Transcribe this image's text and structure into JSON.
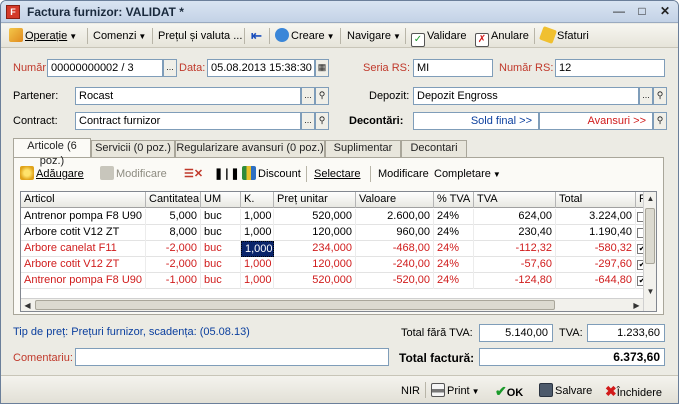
{
  "window": {
    "title": "Factura furnizor: VALIDAT *",
    "app_icon": "F"
  },
  "toolbar": {
    "operatie": "Operație",
    "comenzi": "Comenzi",
    "pretul": "Prețul și valuta ...",
    "creare": "Creare",
    "navigare": "Navigare",
    "validare": "Validare",
    "anulare": "Anulare",
    "sfaturi": "Sfaturi"
  },
  "form": {
    "numar_label": "Număr:",
    "numar_value": "00000000002 / 3",
    "data_label": "Data:",
    "data_value": "05.08.2013 15:38:30",
    "seria_rs_label": "Seria RS:",
    "seria_rs_value": "MI",
    "numar_rs_label": "Număr RS:",
    "numar_rs_value": "12",
    "partener_label": "Partener:",
    "partener_value": "Rocast",
    "depozit_label": "Depozit:",
    "depozit_value": "Depozit Engross",
    "contract_label": "Contract:",
    "contract_value": "Contract furnizor",
    "decontari_label": "Decontări:",
    "sold_final_link": "Sold final >>",
    "avansuri_link": "Avansuri >>",
    "browse_glyph": "..."
  },
  "tabs": [
    {
      "label": "Articole (6 poz.)"
    },
    {
      "label": "Servicii (0 poz.)"
    },
    {
      "label": "Regularizare avansuri (0 poz.)"
    },
    {
      "label": "Suplimentar"
    },
    {
      "label": "Decontari"
    }
  ],
  "subtoolbar": {
    "adaugare": "Adăugare",
    "modificare": "Modificare",
    "discount": "Discount",
    "selectare": "Selectare",
    "modificare2": "Modificare",
    "completare": "Completare"
  },
  "grid": {
    "columns": [
      "Articol",
      "Cantitatea",
      "UM",
      "K.",
      "Preț unitar",
      "Valoare",
      "% TVA",
      "TVA",
      "Total",
      "R"
    ],
    "rows": [
      {
        "articol": "Antrenor pompa F8 U90",
        "cantitatea": "5,000",
        "um": "buc",
        "k": "1,000",
        "pret": "520,000",
        "valoare": "2.600,00",
        "tva_pct": "24%",
        "tva": "624,00",
        "total": "3.224,00",
        "r": "",
        "neg": false
      },
      {
        "articol": "Arbore cotit V12 ZT",
        "cantitatea": "8,000",
        "um": "buc",
        "k": "1,000",
        "pret": "120,000",
        "valoare": "960,00",
        "tva_pct": "24%",
        "tva": "230,40",
        "total": "1.190,40",
        "r": "",
        "neg": false
      },
      {
        "articol": "Arbore canelat F11",
        "cantitatea": "-2,000",
        "um": "buc",
        "k": "1,000",
        "pret": "234,000",
        "valoare": "-468,00",
        "tva_pct": "24%",
        "tva": "-112,32",
        "total": "-580,32",
        "r": "✔",
        "neg": true
      },
      {
        "articol": "Arbore cotit V12 ZT",
        "cantitatea": "-2,000",
        "um": "buc",
        "k": "1,000",
        "pret": "120,000",
        "valoare": "-240,00",
        "tva_pct": "24%",
        "tva": "-57,60",
        "total": "-297,60",
        "r": "✔",
        "neg": true
      },
      {
        "articol": "Antrenor pompa F8 U90",
        "cantitatea": "-1,000",
        "um": "buc",
        "k": "1,000",
        "pret": "520,000",
        "valoare": "-520,00",
        "tva_pct": "24%",
        "tva": "-124,80",
        "total": "-644,80",
        "r": "✔",
        "neg": true
      }
    ]
  },
  "footer": {
    "tip_pret_label": "Tip de preț:",
    "tip_pret_value": "Prețuri furnizor, scadența:",
    "tip_pret_date": "(05.08.13)",
    "total_fara_tva_label": "Total fără TVA:",
    "total_fara_tva_value": "5.140,00",
    "tva_label": "TVA:",
    "tva_value": "1.233,60",
    "comentariu_label": "Comentariu:",
    "comentariu_value": "",
    "total_factura_label": "Total factură:",
    "total_factura_value": "6.373,60"
  },
  "statusbar": {
    "nir": "NIR",
    "print": "Print",
    "ok": "OK",
    "salvare": "Salvare",
    "inchidere": "Închidere"
  }
}
